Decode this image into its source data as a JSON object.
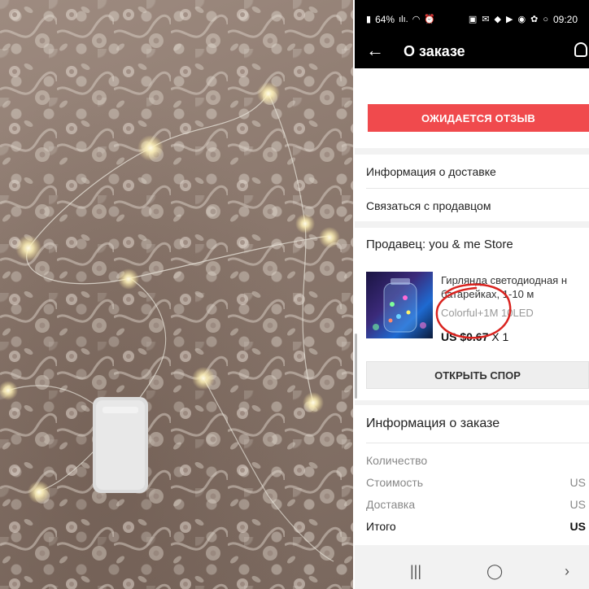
{
  "statusbar": {
    "battery": "64%",
    "time": "09:20"
  },
  "appbar": {
    "back_icon": "arrow-left-icon",
    "title": "О заказе",
    "help_icon": "headset-icon"
  },
  "review_button": "ОЖИДАЕТСЯ ОТЗЫВ",
  "links": {
    "delivery_info": "Информация о доставке",
    "contact_seller": "Связаться с продавцом"
  },
  "seller": {
    "label": "Продавец: you & me Store"
  },
  "product": {
    "title_line1": "Гирлянда светодиодная н",
    "title_line2": "батарейках, 1-10 м",
    "variant": "Colorful+1M 10LED",
    "price": "US $0.67",
    "qty": "X 1"
  },
  "dispute_button": "ОТКРЫТЬ СПОР",
  "order_info": {
    "heading": "Информация о заказе",
    "rows": [
      {
        "label": "Количество",
        "value": ""
      },
      {
        "label": "Стоимость",
        "value": "US"
      },
      {
        "label": "Доставка",
        "value": "US"
      },
      {
        "label": "Итого",
        "value": "US"
      }
    ]
  },
  "colors": {
    "accent": "#f04a4d",
    "annotation": "#d9231f"
  }
}
